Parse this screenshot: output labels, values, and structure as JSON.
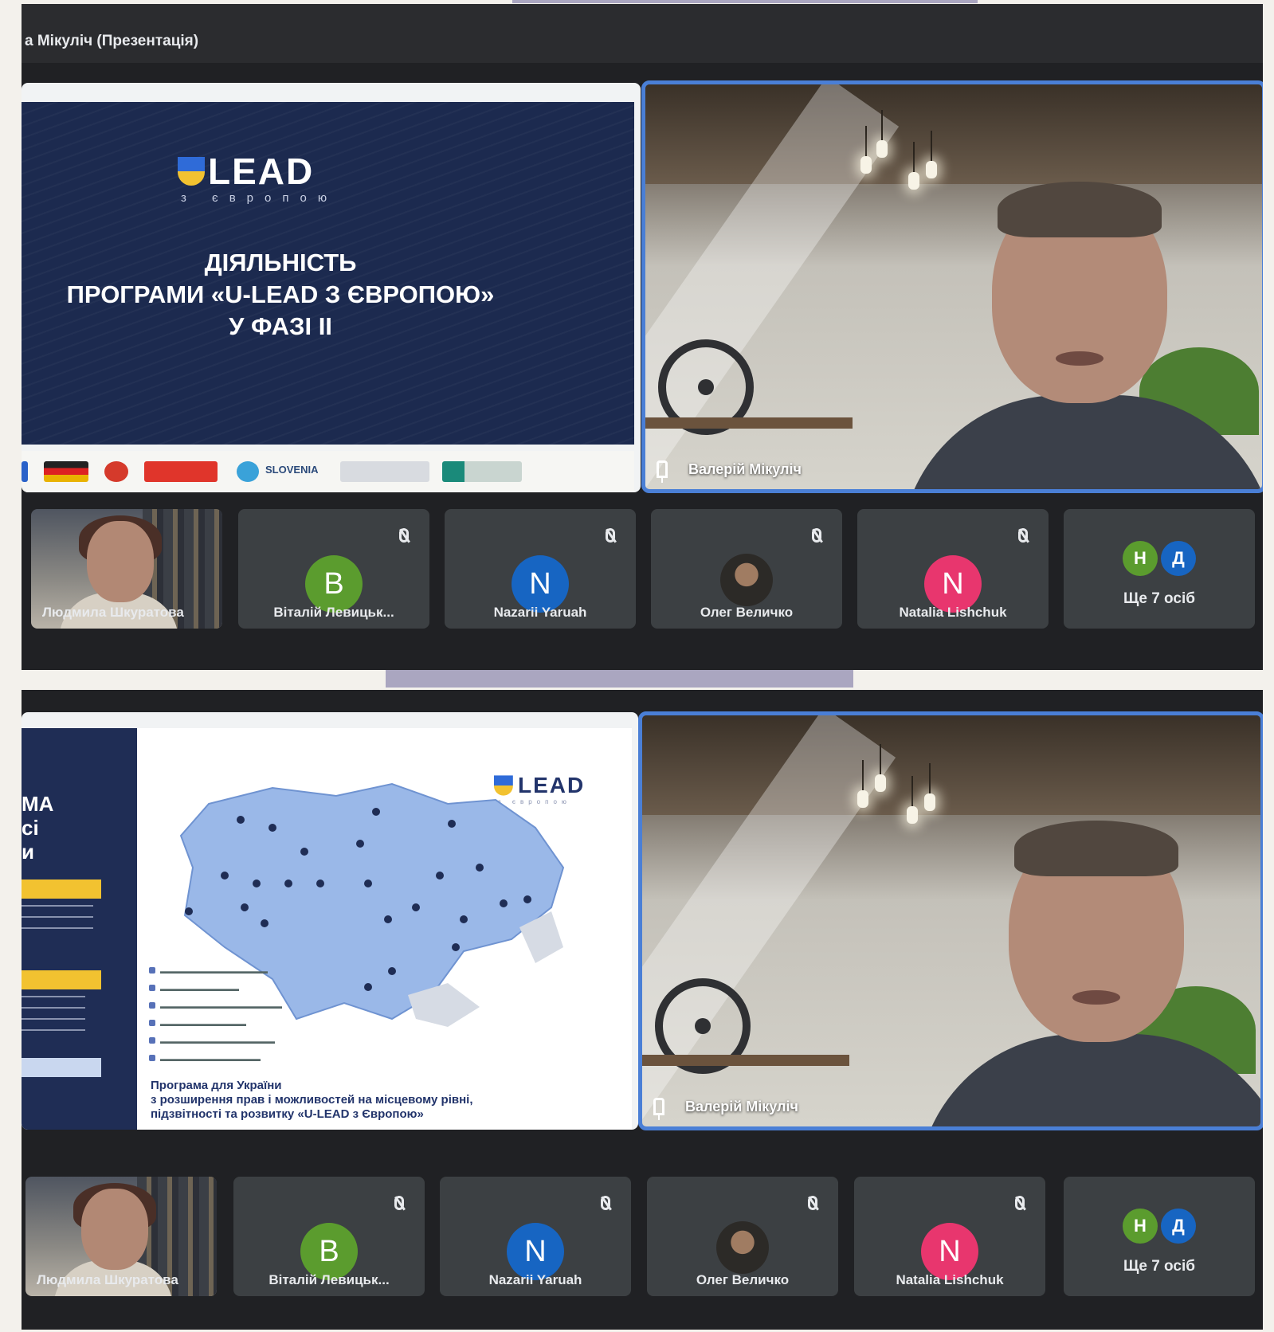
{
  "meeting_title": "а Мікуліч (Презентація)",
  "presentation_1": {
    "logo_text": "LEAD",
    "logo_sub": "з європою",
    "title_lines": [
      "ДІЯЛЬНІСТЬ",
      "ПРОГРАМИ «U-LEAD З ЄВРОПОЮ»",
      "У ФАЗІ ІІ"
    ],
    "partners": [
      "SLOVENIA"
    ]
  },
  "presentation_2": {
    "logo_text": "LEAD",
    "logo_sub": "з європою",
    "sidebar_big": [
      "МА",
      "сі",
      "и"
    ],
    "caption_lines": [
      "Програма для України",
      "з розширення прав і можливостей на місцевому рівні,",
      "підзвітності та розвитку «U-LEAD з Європою»"
    ]
  },
  "speaker": {
    "name": "Валерій Мікуліч"
  },
  "participants": [
    {
      "name": "Людмила Шкуратова",
      "initial": "",
      "color": ""
    },
    {
      "name": "Віталій Левицьк...",
      "initial": "В",
      "color": "#5b9c2e"
    },
    {
      "name": "Nazarii Yaruah",
      "initial": "N",
      "color": "#1765c2"
    },
    {
      "name": "Олег Величко",
      "initial": "",
      "color": ""
    },
    {
      "name": "Natalia Lishchuk",
      "initial": "N",
      "color": "#e8366e"
    }
  ],
  "more": {
    "label": "Ще 7 осіб",
    "mini_initials": [
      "Н",
      "Д"
    ],
    "mini_colors": [
      "#5b9c2e",
      "#1765c2"
    ]
  },
  "colors": {
    "speaker_border": "#4a7fd6",
    "dark_bg": "#202124",
    "tile_bg": "#3c4043",
    "slide_navy": "#1c2a4f",
    "accent_yellow": "#f2c230"
  }
}
